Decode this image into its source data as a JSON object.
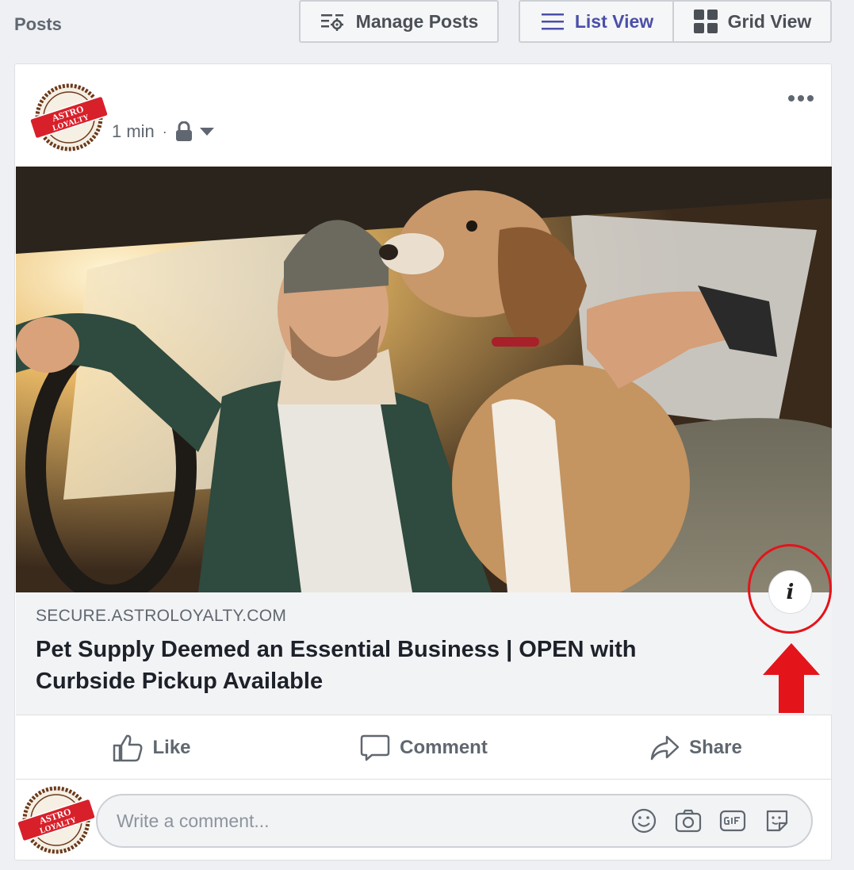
{
  "header": {
    "section_title": "Posts",
    "manage_label": "Manage Posts",
    "list_view_label": "List View",
    "grid_view_label": "Grid View"
  },
  "post": {
    "avatar_text_line1": "ASTRO",
    "avatar_text_line2": "LOYALTY",
    "time": "1 min",
    "separator": "·",
    "privacy_icon": "lock-icon",
    "link": {
      "domain": "SECURE.ASTROLOYALTY.COM",
      "title": "Pet Supply Deemed an Essential Business | OPEN with Curbside Pickup Available"
    },
    "info_glyph": "i",
    "actions": {
      "like": "Like",
      "comment": "Comment",
      "share": "Share"
    },
    "comment_placeholder": "Write a comment..."
  },
  "colors": {
    "accent": "#4b4fa8",
    "annotation": "#e4141b",
    "page_bg": "#eef0f3"
  }
}
